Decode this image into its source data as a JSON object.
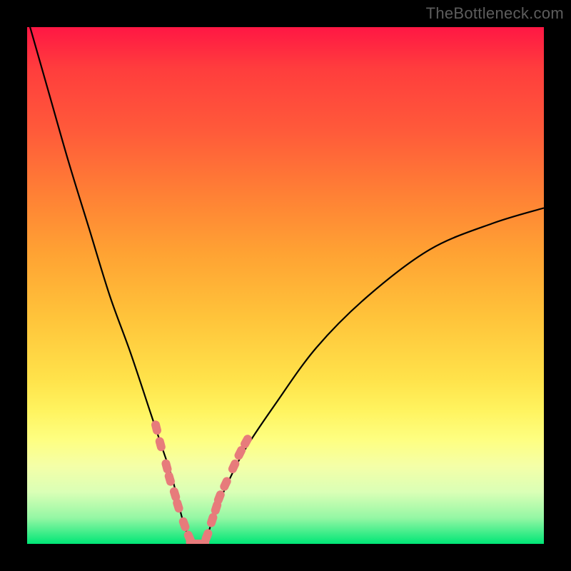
{
  "watermark": "TheBottleneck.com",
  "chart_data": {
    "type": "line",
    "title": "",
    "xlabel": "",
    "ylabel": "",
    "xlim": [
      0,
      100
    ],
    "ylim": [
      0,
      100
    ],
    "grid": false,
    "legend": false,
    "background_gradient": {
      "top": "#ff1744",
      "middle": "#ffe24a",
      "bottom": "#00e676"
    },
    "series": [
      {
        "name": "bottleneck-curve",
        "color": "#000000",
        "x": [
          0,
          4,
          8,
          12,
          16,
          20,
          24,
          26,
          28,
          29,
          30,
          31,
          32,
          33,
          34,
          35,
          36,
          38,
          42,
          48,
          56,
          66,
          78,
          90,
          100
        ],
        "y": [
          102,
          88,
          74,
          61,
          48,
          37,
          25,
          19,
          13,
          9,
          5,
          2,
          0,
          0,
          0,
          2,
          5,
          10,
          18,
          27,
          38,
          48,
          57,
          62,
          65
        ]
      },
      {
        "name": "data-markers",
        "color": "#e77b7b",
        "marker": "capsule",
        "x": [
          25.0,
          25.8,
          27.0,
          27.6,
          28.6,
          29.2,
          30.4,
          31.4,
          32.0,
          33.0,
          34.0,
          34.8,
          35.8,
          36.6,
          37.2,
          38.4,
          40.0,
          41.2,
          42.4
        ],
        "y": [
          22.5,
          19.3,
          15.0,
          12.6,
          9.6,
          7.4,
          3.8,
          1.2,
          0.0,
          0.0,
          0.0,
          1.5,
          4.6,
          7.0,
          9.0,
          11.6,
          15.0,
          17.6,
          19.8
        ]
      }
    ]
  }
}
